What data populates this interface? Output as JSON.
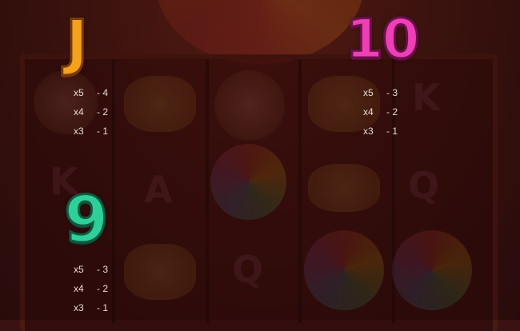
{
  "symbols": [
    {
      "id": "J",
      "label": "J",
      "color": "#f4a21c",
      "payouts": [
        {
          "count": "x5",
          "value": "- 4"
        },
        {
          "count": "x4",
          "value": "- 2"
        },
        {
          "count": "x3",
          "value": "- 1"
        }
      ]
    },
    {
      "id": "10",
      "label": "10",
      "color": "#ee3fb6",
      "payouts": [
        {
          "count": "x5",
          "value": "- 3"
        },
        {
          "count": "x4",
          "value": "- 2"
        },
        {
          "count": "x3",
          "value": "- 1"
        }
      ]
    },
    {
      "id": "9",
      "label": "9",
      "color": "#2fcf9a",
      "payouts": [
        {
          "count": "x5",
          "value": "- 3"
        },
        {
          "count": "x4",
          "value": "- 2"
        },
        {
          "count": "x3",
          "value": "- 1"
        }
      ]
    }
  ],
  "background_reel_letters": [
    "K",
    "A",
    "K",
    "Q",
    "Q"
  ]
}
